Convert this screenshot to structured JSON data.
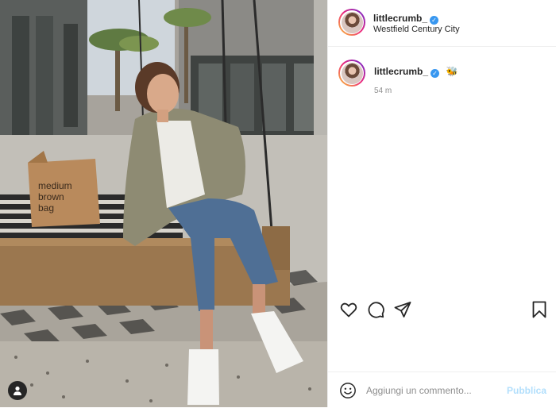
{
  "post": {
    "photo": {
      "alt_icon": "person-tag-icon",
      "bag_text": "medium brown bag"
    },
    "header": {
      "username": "littlecrumb_",
      "verified_icon": "verified-badge-icon",
      "location": "Westfield Century City"
    },
    "caption": {
      "username": "littlecrumb_",
      "verified_icon": "verified-badge-icon",
      "emoji": "🐝",
      "time": "54 m"
    },
    "actions": {
      "like_icon": "heart-icon",
      "comment_icon": "comment-bubble-icon",
      "share_icon": "paper-plane-icon",
      "save_icon": "bookmark-icon"
    },
    "add_comment": {
      "emoji_icon": "smiley-icon",
      "placeholder": "Aggiungi un commento...",
      "publish_label": "Pubblica"
    }
  }
}
